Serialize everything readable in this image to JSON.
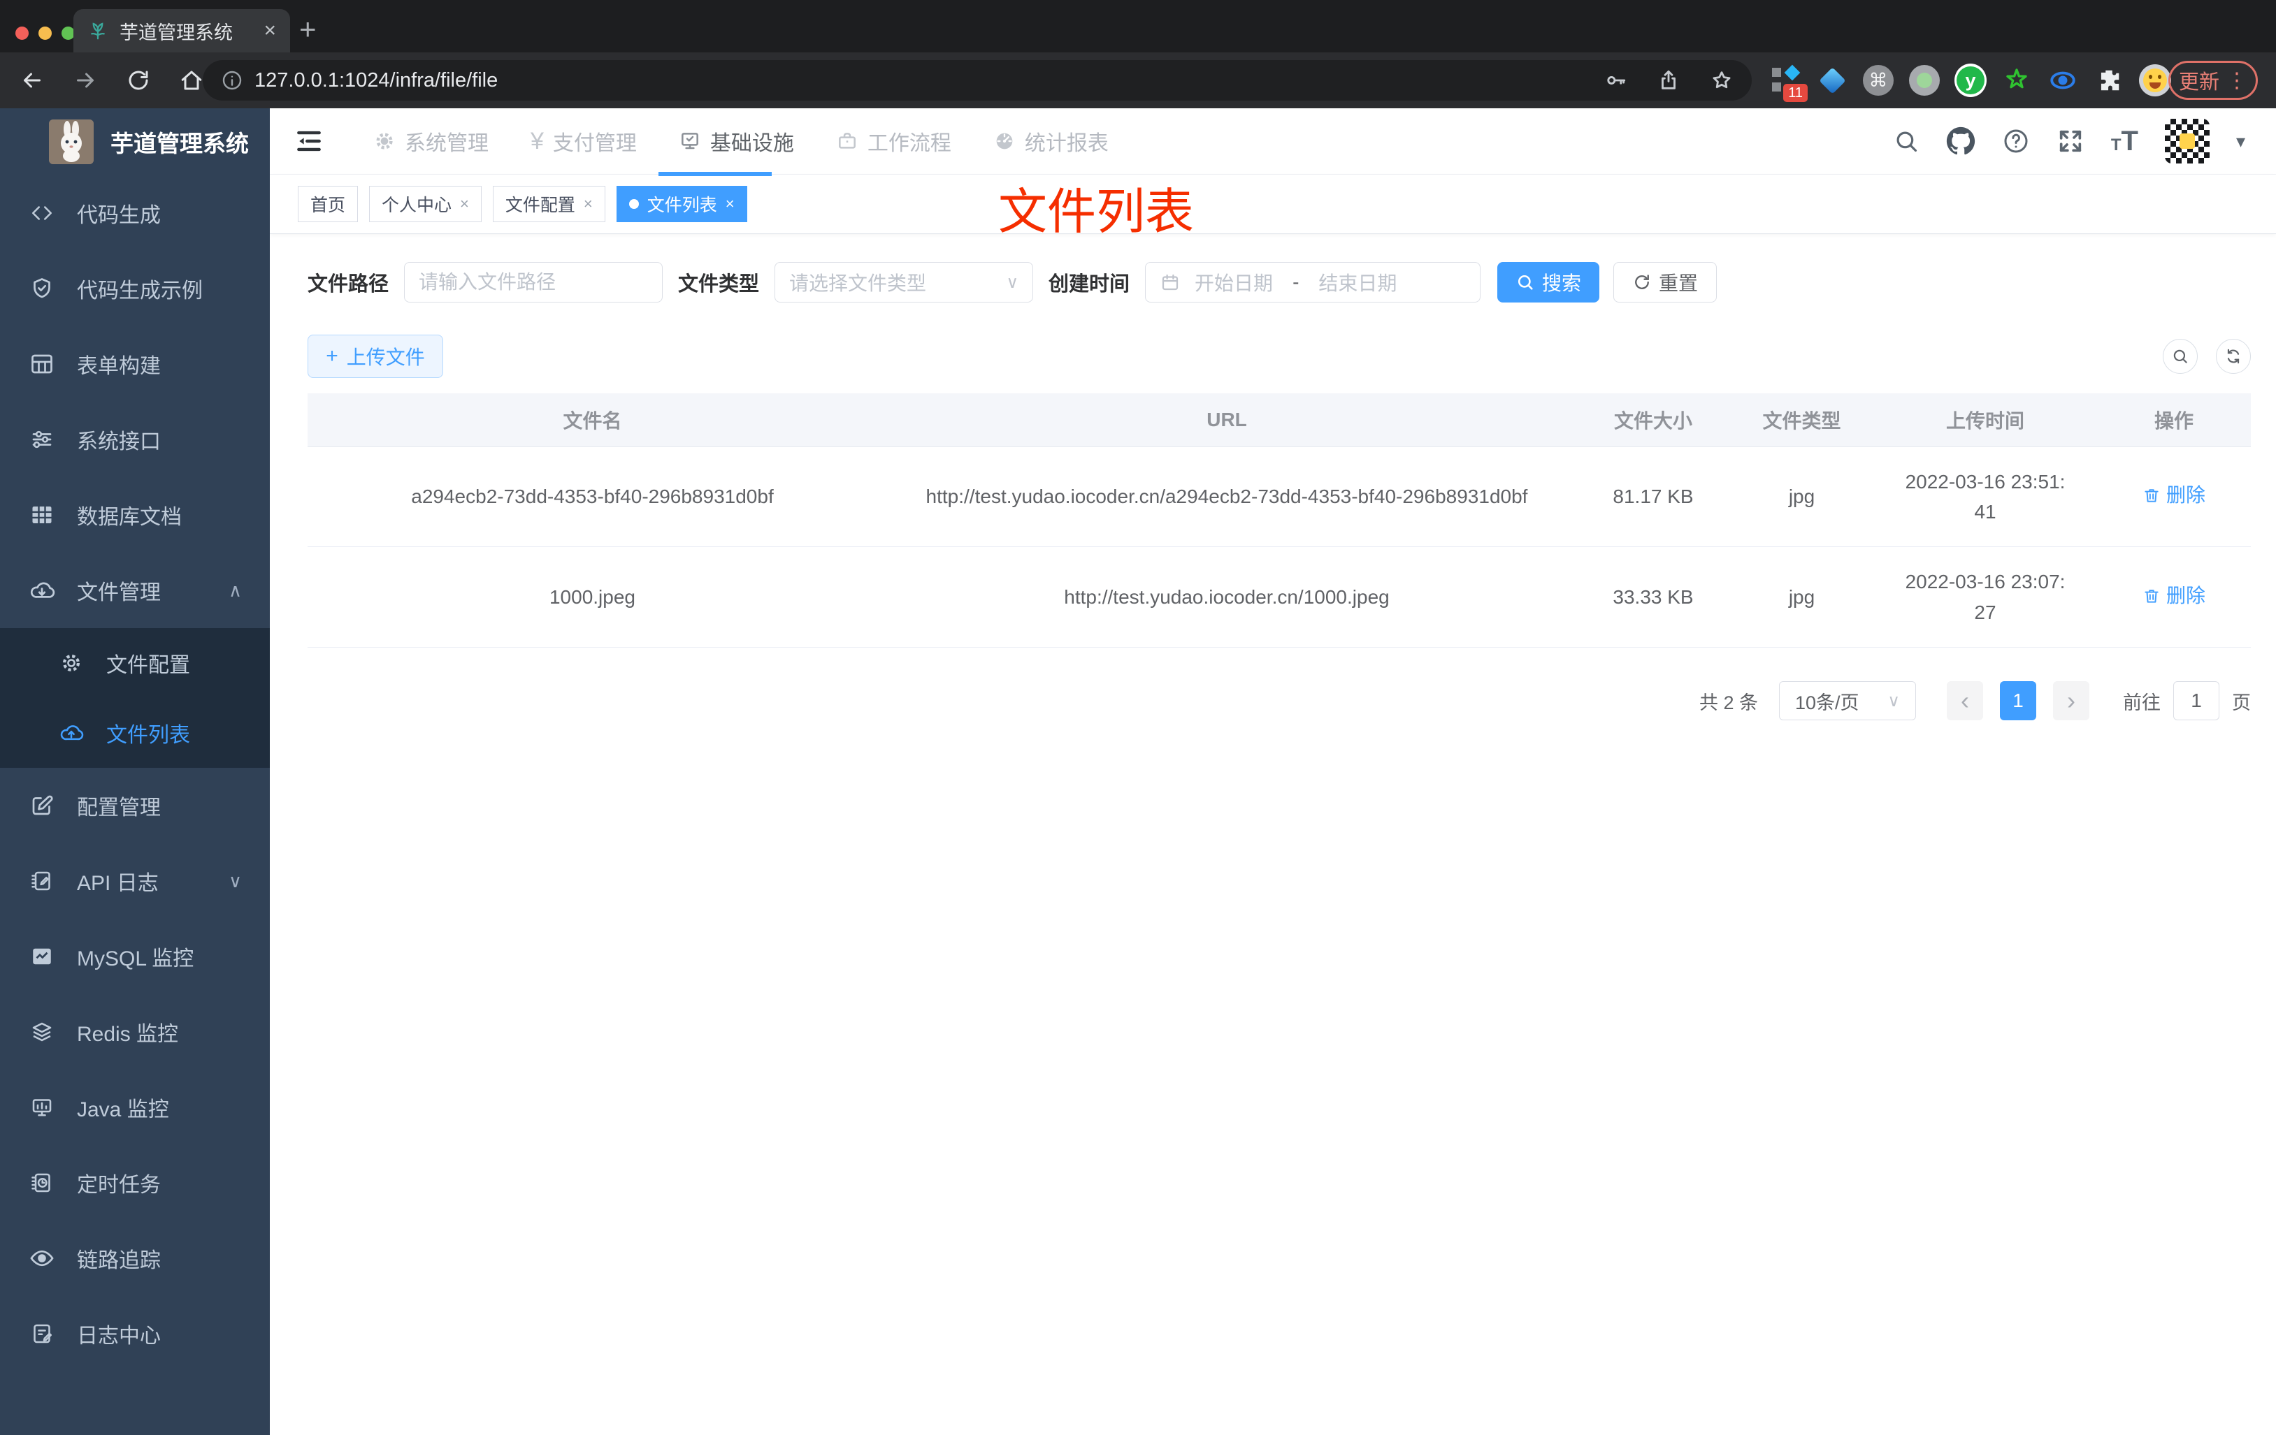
{
  "chrome": {
    "tab_title": "芋道管理系统",
    "url": "127.0.0.1:1024/infra/file/file",
    "ext_badge": "11",
    "update_label": "更新"
  },
  "glyphs": {
    "close": "×",
    "new_tab": "+",
    "yuan": "¥",
    "command": "⌘",
    "y_logo": "y",
    "question": "?",
    "caret_down": "▾",
    "chevron_down": "∨",
    "chevron_up": "∧",
    "prev": "‹",
    "next": "›",
    "dots": "⋮",
    "plus": "+",
    "font_small": "T",
    "font_big": "T"
  },
  "sidebar": {
    "title": "芋道管理系统",
    "items": [
      {
        "label": "代码生成"
      },
      {
        "label": "代码生成示例"
      },
      {
        "label": "表单构建"
      },
      {
        "label": "系统接口"
      },
      {
        "label": "数据库文档"
      },
      {
        "label": "文件管理",
        "children": [
          {
            "label": "文件配置"
          },
          {
            "label": "文件列表"
          }
        ]
      },
      {
        "label": "配置管理"
      },
      {
        "label": "API 日志"
      },
      {
        "label": "MySQL 监控"
      },
      {
        "label": "Redis 监控"
      },
      {
        "label": "Java 监控"
      },
      {
        "label": "定时任务"
      },
      {
        "label": "链路追踪"
      },
      {
        "label": "日志中心"
      }
    ]
  },
  "nav": {
    "items": [
      {
        "label": "系统管理"
      },
      {
        "label": "支付管理"
      },
      {
        "label": "基础设施"
      },
      {
        "label": "工作流程"
      },
      {
        "label": "统计报表"
      }
    ]
  },
  "tags": [
    {
      "label": "首页"
    },
    {
      "label": "个人中心"
    },
    {
      "label": "文件配置"
    },
    {
      "label": "文件列表"
    }
  ],
  "annotation": "文件列表",
  "filter": {
    "path_label": "文件路径",
    "path_placeholder": "请输入文件路径",
    "type_label": "文件类型",
    "type_placeholder": "请选择文件类型",
    "date_label": "创建时间",
    "date_start": "开始日期",
    "date_separator": "-",
    "date_end": "结束日期",
    "search_label": "搜索",
    "reset_label": "重置"
  },
  "toolbar": {
    "upload_label": "上传文件"
  },
  "table": {
    "headers": [
      "文件名",
      "URL",
      "文件大小",
      "文件类型",
      "上传时间",
      "操作"
    ],
    "rows": [
      {
        "name": "a294ecb2-73dd-4353-bf40-296b8931d0bf",
        "url": "http://test.yudao.iocoder.cn/a294ecb2-73dd-4353-bf40-296b8931d0bf",
        "size": "81.17 KB",
        "type": "jpg",
        "time": "2022-03-16 23:51:41",
        "action": "删除"
      },
      {
        "name": "1000.jpeg",
        "url": "http://test.yudao.iocoder.cn/1000.jpeg",
        "size": "33.33 KB",
        "type": "jpg",
        "time": "2022-03-16 23:07:27",
        "action": "删除"
      }
    ]
  },
  "pagination": {
    "total": "共 2 条",
    "page_size": "10条/页",
    "current_page": "1",
    "goto_label": "前往",
    "goto_value": "1",
    "page_unit": "页"
  },
  "colors": {
    "accent": "#409eff",
    "annotation_red": "#f52e00",
    "sidebar_bg": "#304156",
    "submenu_bg": "#1f2d3d"
  }
}
